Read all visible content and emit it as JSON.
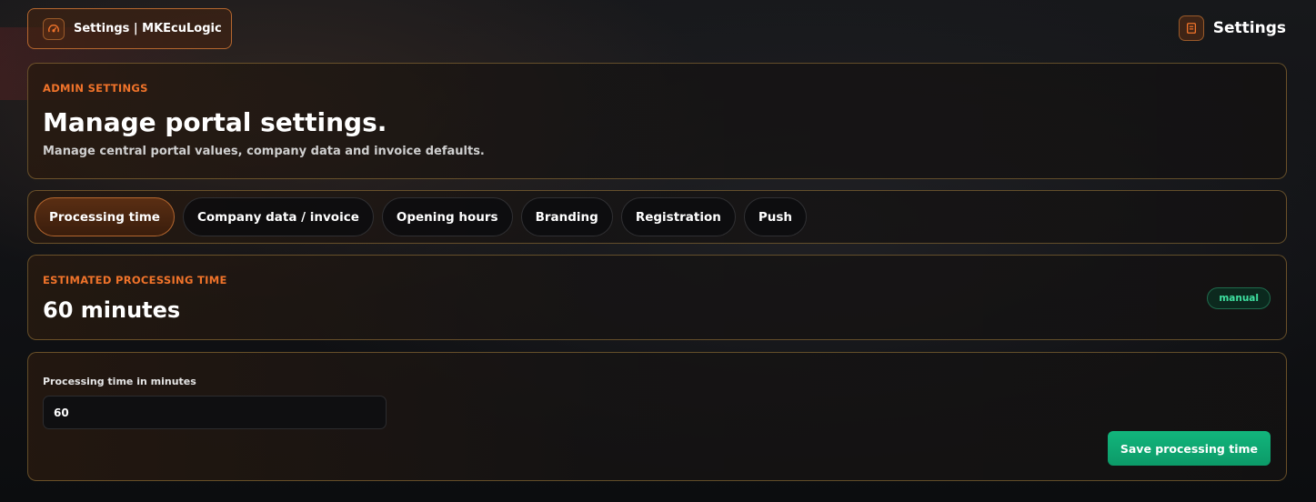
{
  "topbar": {
    "brand_label": "Settings | MKEcuLogic",
    "brand_icon": "gauge-icon",
    "page_label": "Settings",
    "page_icon": "document-icon"
  },
  "hero": {
    "eyebrow": "ADMIN SETTINGS",
    "title": "Manage portal settings.",
    "subtitle": "Manage central portal values, company data and invoice defaults."
  },
  "tabs": [
    {
      "label": "Processing time",
      "active": true
    },
    {
      "label": "Company data / invoice",
      "active": false
    },
    {
      "label": "Opening hours",
      "active": false
    },
    {
      "label": "Branding",
      "active": false
    },
    {
      "label": "Registration",
      "active": false
    },
    {
      "label": "Push",
      "active": false
    }
  ],
  "status": {
    "eyebrow": "ESTIMATED PROCESSING TIME",
    "value": "60 minutes",
    "badge": "manual"
  },
  "form": {
    "field_label": "Processing time in minutes",
    "field_value": "60",
    "save_label": "Save processing time"
  },
  "colors": {
    "accent": "#f0732a",
    "success": "#12b57c",
    "badge_text": "#3ee0a0"
  }
}
